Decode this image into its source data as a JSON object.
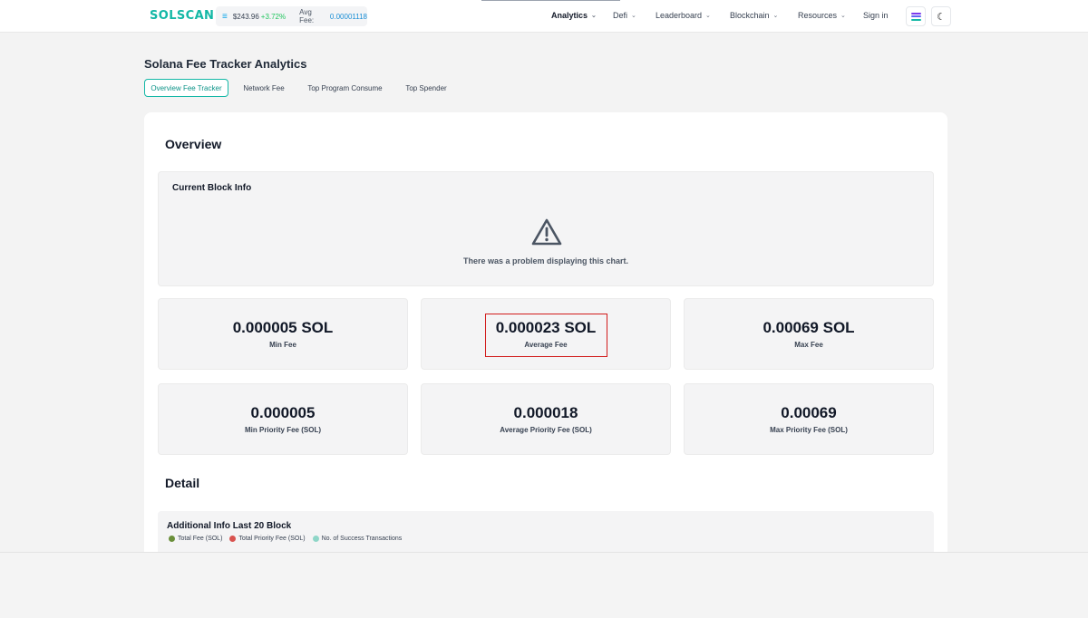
{
  "header": {
    "logo": "SOLSCAN",
    "price": "$243.96",
    "price_change": "+3.72%",
    "avg_fee_label": "Avg Fee:",
    "avg_fee_value": "0.00001118",
    "nav": [
      "Analytics",
      "Defi",
      "Leaderboard",
      "Blockchain",
      "Resources"
    ],
    "sign_in": "Sign in"
  },
  "page": {
    "title": "Solana Fee Tracker Analytics",
    "tabs": [
      "Overview Fee Tracker",
      "Network Fee",
      "Top Program Consume",
      "Top Spender"
    ],
    "active_tab": "Overview Fee Tracker"
  },
  "overview": {
    "heading": "Overview",
    "block_info": {
      "title": "Current Block Info",
      "error": "There was a problem displaying this chart."
    },
    "stats": [
      {
        "value": "0.000005 SOL",
        "label": "Min Fee"
      },
      {
        "value": "0.000023 SOL",
        "label": "Average Fee"
      },
      {
        "value": "0.00069 SOL",
        "label": "Max Fee"
      },
      {
        "value": "0.000005",
        "label": "Min Priority Fee (SOL)"
      },
      {
        "value": "0.000018",
        "label": "Average Priority Fee (SOL)"
      },
      {
        "value": "0.00069",
        "label": "Max Priority Fee (SOL)"
      }
    ]
  },
  "detail": {
    "heading": "Detail",
    "additional_title": "Additional Info Last 20 Block",
    "legend": [
      {
        "label": "Total Fee (SOL)",
        "color": "#6a8f3a"
      },
      {
        "label": "Total Priority Fee (SOL)",
        "color": "#d9534f"
      },
      {
        "label": "No. of Success Transactions",
        "color": "#8fd6c8"
      }
    ]
  },
  "colors": {
    "accent": "#14b8a6",
    "highlight_box": "#d11b1b"
  },
  "icons": [
    "menu-icon",
    "chevron-down-icon",
    "solana-network-icon",
    "moon-icon",
    "warning-icon"
  ]
}
